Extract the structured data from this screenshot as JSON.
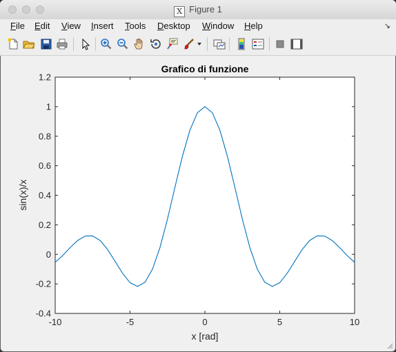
{
  "window": {
    "title": "Figure 1",
    "title_icon_glyph": "X"
  },
  "menu": [
    {
      "pre": "",
      "u": "F",
      "post": "ile"
    },
    {
      "pre": "",
      "u": "E",
      "post": "dit"
    },
    {
      "pre": "",
      "u": "V",
      "post": "iew"
    },
    {
      "pre": "",
      "u": "I",
      "post": "nsert"
    },
    {
      "pre": "",
      "u": "T",
      "post": "ools"
    },
    {
      "pre": "",
      "u": "D",
      "post": "esktop"
    },
    {
      "pre": "",
      "u": "W",
      "post": "indow"
    },
    {
      "pre": "",
      "u": "H",
      "post": "elp"
    }
  ],
  "toolbar_icons": [
    "new-figure-icon",
    "open-folder-icon",
    "save-icon",
    "print-icon",
    "pointer-icon",
    "zoom-in-icon",
    "zoom-out-icon",
    "pan-hand-icon",
    "rotate-3d-icon",
    "data-cursor-icon",
    "brush-icon",
    "brush-dropdown-icon",
    "link-plot-icon",
    "colorbar-icon",
    "legend-icon",
    "hide-plot-tools-icon",
    "show-plot-tools-icon"
  ],
  "colors": {
    "line": "#0072bd",
    "axes_bg": "#ffffff",
    "figure_bg": "#f0f0f0"
  },
  "chart_data": {
    "type": "line",
    "title": "Grafico di funzione",
    "xlabel": "x [rad]",
    "ylabel": "sin(x)/x",
    "xlim": [
      -10,
      10
    ],
    "ylim": [
      -0.4,
      1.2
    ],
    "xticks": [
      "-10",
      "-5",
      "0",
      "5",
      "10"
    ],
    "xtick_values": [
      -10,
      -5,
      0,
      5,
      10
    ],
    "yticks": [
      "-0.4",
      "-0.2",
      "0",
      "0.2",
      "0.4",
      "0.6",
      "0.8",
      "1",
      "1.2"
    ],
    "ytick_values": [
      -0.4,
      -0.2,
      0,
      0.2,
      0.4,
      0.6,
      0.8,
      1,
      1.2
    ],
    "grid": false,
    "series": [
      {
        "x": [
          -10,
          -9.5,
          -9,
          -8.5,
          -8,
          -7.5,
          -7,
          -6.5,
          -6,
          -5.5,
          -5,
          -4.5,
          -4,
          -3.5,
          -3,
          -2.5,
          -2,
          -1.5,
          -1,
          -0.5,
          0,
          0.5,
          1,
          1.5,
          2,
          2.5,
          3,
          3.5,
          4,
          4.5,
          5,
          5.5,
          6,
          6.5,
          7,
          7.5,
          8,
          8.5,
          9,
          9.5,
          10
        ],
        "y": [
          -0.054,
          -0.008,
          0.046,
          0.094,
          0.124,
          0.125,
          0.094,
          0.033,
          -0.047,
          -0.128,
          -0.192,
          -0.217,
          -0.189,
          -0.1,
          0.047,
          0.239,
          0.455,
          0.665,
          0.841,
          0.959,
          1,
          0.959,
          0.841,
          0.665,
          0.455,
          0.239,
          0.047,
          -0.1,
          -0.189,
          -0.217,
          -0.192,
          -0.128,
          -0.047,
          0.033,
          0.094,
          0.125,
          0.124,
          0.094,
          0.046,
          -0.008,
          -0.054
        ]
      }
    ]
  }
}
